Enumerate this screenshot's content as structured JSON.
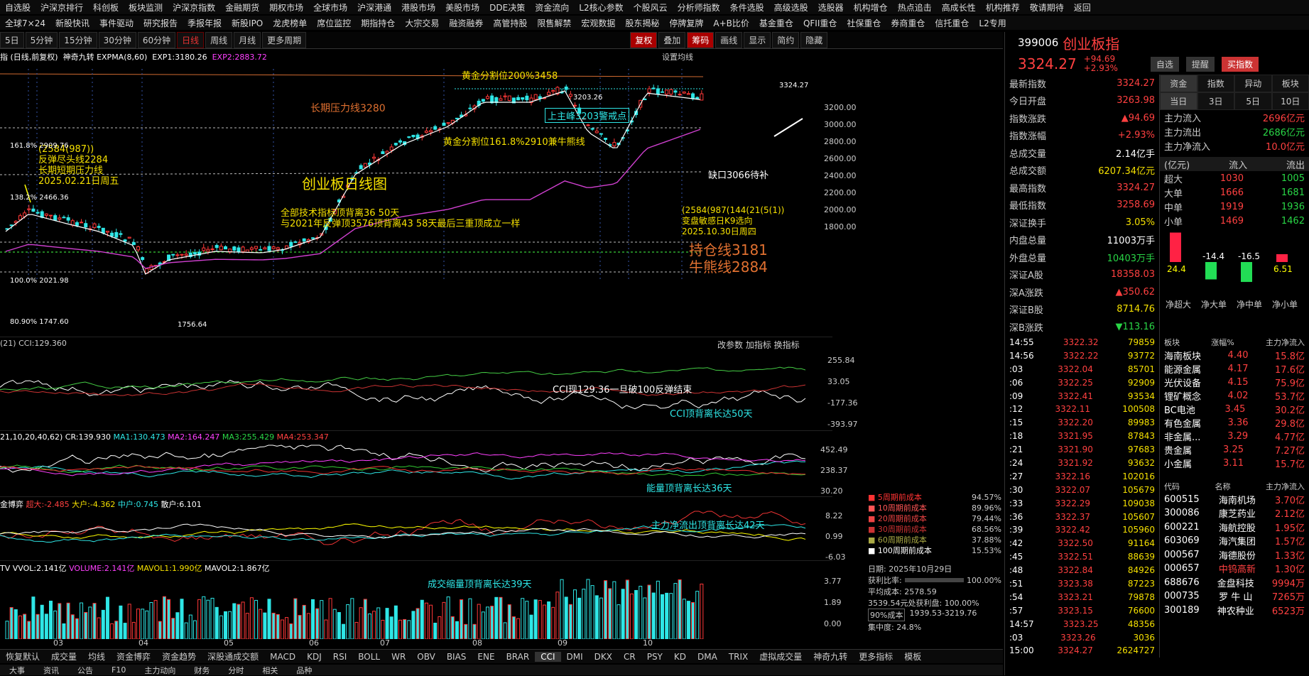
{
  "nav1": [
    "自选股",
    "沪深京排行",
    "科创板",
    "板块监测",
    "沪深京指数",
    "金融期货",
    "期权市场",
    "全球市场",
    "沪深港通",
    "港股市场",
    "美股市场",
    "DDE决策",
    "资金流向",
    "L2核心参数",
    "个股风云",
    "分析师指数",
    "条件选股",
    "高级选股",
    "选股器",
    "机构增仓",
    "热点追击",
    "高成长性",
    "机构推荐",
    "敬请期待",
    "返回"
  ],
  "nav2": [
    "全球7×24",
    "新股快讯",
    "事件驱动",
    "研究报告",
    "季报年报",
    "新股IPO",
    "龙虎榜单",
    "席位监控",
    "期指持仓",
    "大宗交易",
    "融资融券",
    "高管持股",
    "限售解禁",
    "宏观数据",
    "股东揭秘",
    "停牌复牌",
    "A+B比价",
    "基金重仓",
    "QFII重仓",
    "社保重仓",
    "券商重仓",
    "信托重仓",
    "L2专用"
  ],
  "toolbar": {
    "periods": [
      "5日",
      "5分钟",
      "15分钟",
      "30分钟",
      "60分钟",
      "日线",
      "周线",
      "月线",
      "更多周期"
    ],
    "active": "日线",
    "right": [
      "复权",
      "叠加",
      "筹码",
      "画线",
      "显示",
      "简约",
      "隐藏"
    ]
  },
  "info": {
    "name": "指 (日线,前复权)",
    "indicator": "神奇九转 EXPMA(8,60)",
    "exp1": "EXP1:3180.26",
    "exp2": "EXP2:2883.72",
    "settings": "设置均线"
  },
  "main_annotations": {
    "golden200": "黄金分割位200%3458",
    "long_resist": "长期压力线3280",
    "peak_label": "3203.26",
    "peak_warn": "上主峰3203警戒点",
    "golden161": "黄金分割位161.8%2910兼牛熊线",
    "rebound": "(2584(987))",
    "rebound2": "反弹尽头线2284",
    "short_resist": "长期短期压力线",
    "date1": "2025.02.21日周五",
    "title": "创业板日线图",
    "diverge": "全部技术指标顶背离36 50天",
    "compare": "与2021年反弹顶3576顶背离43 58天最后三重顶成立一样",
    "gap": "缺口3066待补",
    "nine": "(2584(987(144(21(5(1))",
    "turn": "变盘敏感日K9选向",
    "date2": "2025.10.30日周四",
    "hold": "持仓线3181",
    "bull": "牛熊线2884",
    "lv1618": "161.8% 2909.76",
    "lv1382": "138.2% 2466.36",
    "lv100": "100.0% 2021.98",
    "lv809": "80.90% 1747.60",
    "low": "1756.64",
    "last": "3324.27"
  },
  "main_scale": [
    "3200.00",
    "3000.00",
    "2800.00",
    "2600.00",
    "2400.00",
    "2200.00",
    "2000.00",
    "1800.00"
  ],
  "cci": {
    "label": "(21) CCI:129.360",
    "tools": "改参数 加指标 换指标",
    "note1": "CCI现129.36一旦破100反弹结束",
    "note2": "CCI顶背离长达50天",
    "scale": [
      "255.84",
      "33.05",
      "-177.36",
      "-393.97"
    ]
  },
  "cr": {
    "label": "21,10,20,40,62) CR:139.930",
    "ma1": "MA1:130.473",
    "ma2": "MA2:164.247",
    "ma3": "MA3:255.429",
    "ma4": "MA4:253.347",
    "note": "能量顶背离长达36天",
    "scale": [
      "452.49",
      "238.37",
      "30.20"
    ]
  },
  "fund": {
    "label": "金博弈",
    "a": "超大:-2.485",
    "b": "大户:-4.362",
    "c": "中户:0.745",
    "d": "散户:6.101",
    "note": "主力净流出顶背离长达42天",
    "scale": [
      "8.22",
      "0.99",
      "-6.03"
    ]
  },
  "vol": {
    "label": "TV VVOL:2.141亿",
    "v2": "VOLUME:2.141亿",
    "m1": "MAVOL1:1.990亿",
    "m2": "MAVOL2:1.867亿",
    "note": "成交缩量顶背离长达39天",
    "scale": [
      "3.77",
      "1.89",
      "0.00"
    ]
  },
  "months": [
    "03",
    "04",
    "05",
    "06",
    "07",
    "08",
    "09",
    "10"
  ],
  "cost": {
    "rows": [
      [
        "5周期前成本",
        "94.57%"
      ],
      [
        "10周期前成本",
        "89.96%"
      ],
      [
        "20周期前成本",
        "79.44%"
      ],
      [
        "30周期前成本",
        "68.56%"
      ],
      [
        "60周期前成本",
        "37.88%"
      ],
      [
        "100周期前成本",
        "15.53%"
      ]
    ],
    "date": "日期: 2025年10月29日",
    "profit_label": "获利比率:",
    "profit": "100.00%",
    "avg": "平均成本: 2578.59",
    "line4": "3539.54元处获利盘: 100.00%",
    "cost90": "90%成本",
    "range": "1939.53-3219.76",
    "conc": "集中度: 24.8%"
  },
  "bottom_tabs": [
    "恢复默认",
    "成交量",
    "均线",
    "资金博弈",
    "资金趋势",
    "深股通成交额",
    "MACD",
    "KDJ",
    "RSI",
    "BOLL",
    "WR",
    "OBV",
    "BIAS",
    "ENE",
    "BRAR",
    "CCI",
    "DMI",
    "DKX",
    "CR",
    "PSY",
    "KD",
    "DMA",
    "TRIX",
    "虚拟成交量",
    "神奇九转",
    "更多指标",
    "模板"
  ],
  "bottom_tabs2": [
    "大事",
    "资讯",
    "公告",
    "F10",
    "主力动向",
    "财务",
    "分时",
    "相关",
    "品种"
  ],
  "right": {
    "code": "399006",
    "name": "创业板指",
    "price": "3324.27",
    "chg": "+94.69",
    "pct": "+2.93%",
    "btn1": "自选",
    "btn2": "提醒",
    "btn3": "买指数",
    "stats": [
      [
        "最新指数",
        "3324.27"
      ],
      [
        "今日开盘",
        "3263.98"
      ],
      [
        "指数涨跌",
        "▲94.69"
      ],
      [
        "指数涨幅",
        "+2.93%"
      ],
      [
        "总成交量",
        "2.14亿手"
      ],
      [
        "总成交额",
        "6207.34亿元"
      ],
      [
        "最高指数",
        "3324.27"
      ],
      [
        "最低指数",
        "3258.69"
      ],
      [
        "深证换手",
        "3.05%"
      ],
      [
        "内盘总量",
        "11003万手"
      ],
      [
        "外盘总量",
        "10403万手"
      ],
      [
        "深证A股",
        "18358.03"
      ],
      [
        "深A涨跌",
        "▲350.62"
      ],
      [
        "深证B股",
        "8714.76"
      ],
      [
        "深B涨跌",
        "▼113.16"
      ]
    ],
    "tabs": [
      "资金",
      "指数",
      "异动",
      "板块"
    ],
    "subtabs": [
      "当日",
      "3日",
      "5日",
      "10日"
    ],
    "flow": [
      [
        "主力流入",
        "2696亿元"
      ],
      [
        "主力流出",
        "2686亿元"
      ],
      [
        "主力净流入",
        "10.0亿元"
      ]
    ],
    "flow_head": [
      "(亿元)",
      "流入",
      "流出"
    ],
    "flow_rows": [
      [
        "超大",
        "1030",
        "1005"
      ],
      [
        "大单",
        "1666",
        "1681"
      ],
      [
        "中单",
        "1919",
        "1936"
      ],
      [
        "小单",
        "1469",
        "1462"
      ]
    ],
    "bars": [
      [
        "24.4",
        "净超大"
      ],
      [
        "-14.4",
        "净大单"
      ],
      [
        "-16.5",
        "净中单"
      ],
      [
        "6.51",
        "净小单"
      ]
    ],
    "ticks": [
      [
        "14:55",
        "3322.32",
        "79859"
      ],
      [
        "14:56",
        "3322.22",
        "93772"
      ],
      [
        ":03",
        "3322.04",
        "85701"
      ],
      [
        ":06",
        "3322.25",
        "92909"
      ],
      [
        ":09",
        "3322.41",
        "93534"
      ],
      [
        ":12",
        "3322.11",
        "100508"
      ],
      [
        ":15",
        "3322.20",
        "89983"
      ],
      [
        ":18",
        "3321.95",
        "87843"
      ],
      [
        ":21",
        "3321.90",
        "97683"
      ],
      [
        ":24",
        "3321.92",
        "93632"
      ],
      [
        ":27",
        "3322.16",
        "102016"
      ],
      [
        ":30",
        "3322.07",
        "105679"
      ],
      [
        ":33",
        "3322.29",
        "109038"
      ],
      [
        ":36",
        "3322.37",
        "105607"
      ],
      [
        ":39",
        "3322.42",
        "105960"
      ],
      [
        ":42",
        "3322.50",
        "91164"
      ],
      [
        ":45",
        "3322.51",
        "88639"
      ],
      [
        ":48",
        "3322.84",
        "84926"
      ],
      [
        ":51",
        "3323.38",
        "87223"
      ],
      [
        ":54",
        "3323.21",
        "79878"
      ],
      [
        ":57",
        "3323.15",
        "76600"
      ],
      [
        "14:57",
        "3323.25",
        "48356"
      ],
      [
        ":03",
        "3323.26",
        "3036"
      ],
      [
        "15:00",
        "3324.27",
        "2624727"
      ]
    ],
    "sect_head": [
      "板块",
      "涨幅%",
      "主力净流入"
    ],
    "sectors": [
      [
        "海南板块",
        "4.40",
        "15.8亿"
      ],
      [
        "能源金属",
        "4.17",
        "17.6亿"
      ],
      [
        "光伏设备",
        "4.15",
        "75.9亿"
      ],
      [
        "锂矿概念",
        "4.02",
        "53.7亿"
      ],
      [
        "BC电池",
        "3.45",
        "30.2亿"
      ],
      [
        "有色金属",
        "3.36",
        "29.8亿"
      ],
      [
        "非金属...",
        "3.29",
        "4.77亿"
      ],
      [
        "贵金属",
        "3.25",
        "7.27亿"
      ],
      [
        "小金属",
        "3.11",
        "15.7亿"
      ]
    ],
    "stk_head": [
      "代码",
      "名称",
      "主力净流入"
    ],
    "stocks": [
      [
        "600515",
        "海南机场",
        "3.70亿"
      ],
      [
        "300086",
        "康芝药业",
        "2.12亿"
      ],
      [
        "600221",
        "海航控股",
        "1.95亿"
      ],
      [
        "603069",
        "海汽集团",
        "1.57亿"
      ],
      [
        "000567",
        "海德股份",
        "1.33亿"
      ],
      [
        "000657",
        "中钨高新",
        "1.30亿"
      ],
      [
        "688676",
        "金盘科技",
        "9994万"
      ],
      [
        "000735",
        "罗 牛 山",
        "7265万"
      ],
      [
        "300189",
        "神农种业",
        "6523万"
      ]
    ]
  }
}
